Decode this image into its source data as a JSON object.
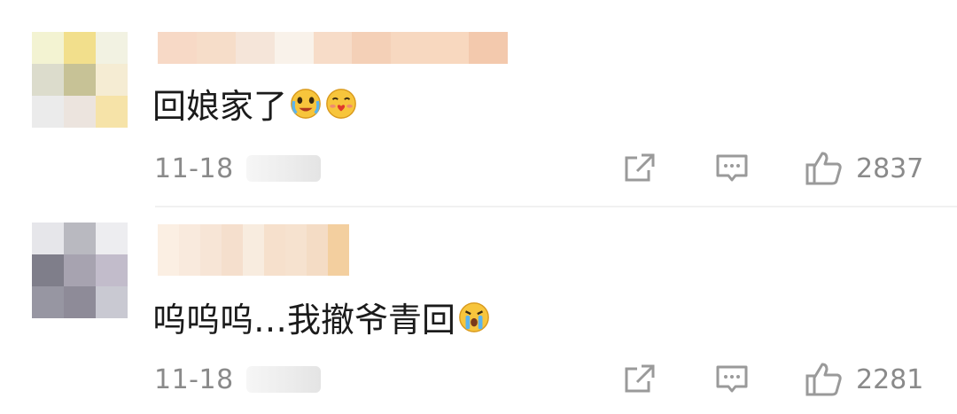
{
  "colors": {
    "text": "#1b1b1b",
    "meta": "#8a8a8a",
    "icon": "#9a9a9a",
    "divider": "#f1f1f1"
  },
  "comments": [
    {
      "text": "回娘家了",
      "emojis": [
        "crying-happy-face-emoji",
        "kiss-heart-face-emoji"
      ],
      "date": "11-18",
      "likes": "2837",
      "avatar_blur": [
        "#f3f3d2",
        "#f2df8c",
        "#f2f2e2",
        "#dcdccc",
        "#c7c296",
        "#f5ecd3",
        "#ebebeb",
        "#ece4de",
        "#f6e3a8"
      ],
      "username_blur": [
        "#f7d9c6",
        "#f6ddc9",
        "#f5e5d9",
        "#f9f2ea",
        "#f7dcc8",
        "#f4d0b7",
        "#f7d8c0",
        "#f8d8bf",
        "#f3c9ad"
      ]
    },
    {
      "text": "呜呜呜…我撤爷青回",
      "emojis": [
        "crying-face-emoji"
      ],
      "date": "11-18",
      "likes": "2281",
      "avatar_blur": [
        "#e6e6ea",
        "#b9b9c0",
        "#ededf0",
        "#7f7e8a",
        "#a7a3b0",
        "#c2bccb",
        "#9796a2",
        "#8e8b98",
        "#c9c9d2"
      ],
      "username_blur": [
        "#fbefe3",
        "#f9eadd",
        "#f7e5d6",
        "#f5dfcd",
        "#f8ecdf",
        "#f6e0cc",
        "#f6e2cf",
        "#f4dcc5",
        "#f3cf9f"
      ]
    }
  ],
  "icons": {
    "share": "share-icon",
    "reply": "comment-icon",
    "like": "thumbs-up-icon"
  }
}
